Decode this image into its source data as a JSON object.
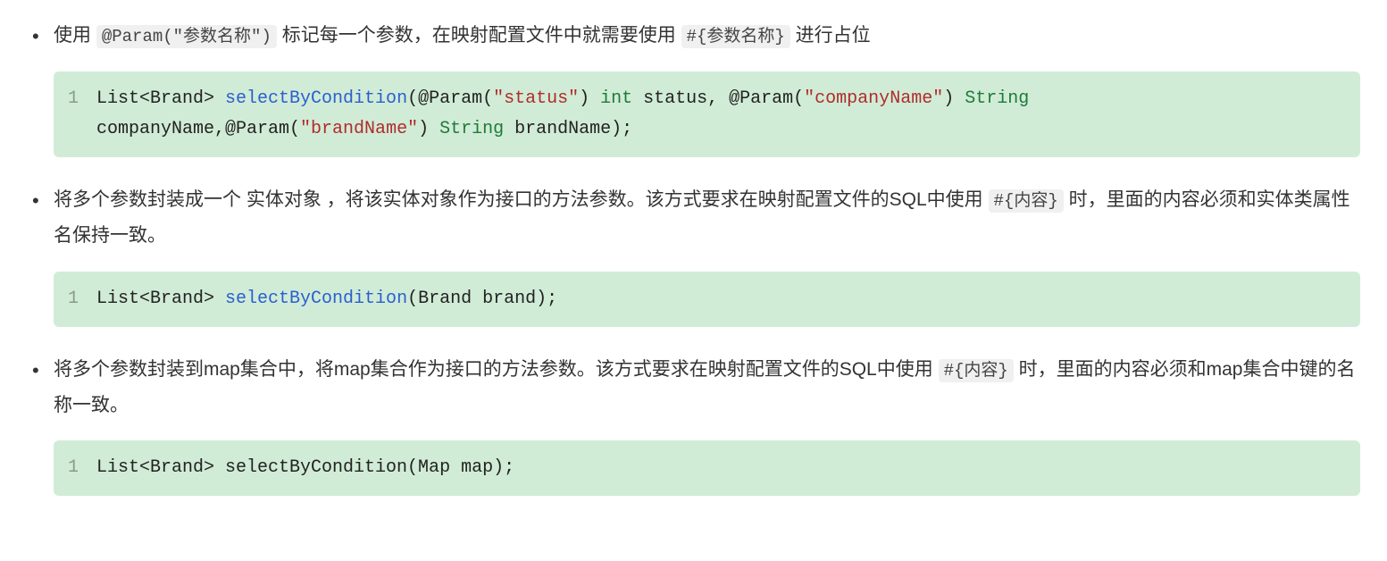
{
  "items": [
    {
      "para_parts": [
        {
          "t": "text",
          "v": "使用 "
        },
        {
          "t": "code",
          "v": "@Param(\"参数名称\")"
        },
        {
          "t": "text",
          "v": " 标记每一个参数，在映射配置文件中就需要使用 "
        },
        {
          "t": "code",
          "v": "#{参数名称}"
        },
        {
          "t": "text",
          "v": " 进行占位"
        }
      ],
      "code_line_no": "1",
      "code_tokens": [
        {
          "c": "plain",
          "v": "List<Brand> "
        },
        {
          "c": "func",
          "v": "selectByCondition"
        },
        {
          "c": "plain",
          "v": "(@Param("
        },
        {
          "c": "str",
          "v": "\"status\""
        },
        {
          "c": "plain",
          "v": ") "
        },
        {
          "c": "kw",
          "v": "int"
        },
        {
          "c": "plain",
          "v": " status, @Param("
        },
        {
          "c": "str",
          "v": "\"companyName\""
        },
        {
          "c": "plain",
          "v": ") "
        },
        {
          "c": "type",
          "v": "String"
        },
        {
          "c": "plain",
          "v": " companyName,@Param("
        },
        {
          "c": "str",
          "v": "\"brandName\""
        },
        {
          "c": "plain",
          "v": ") "
        },
        {
          "c": "type",
          "v": "String"
        },
        {
          "c": "plain",
          "v": " brandName);"
        }
      ]
    },
    {
      "para_parts": [
        {
          "t": "text",
          "v": "将多个参数封装成一个 实体对象 ，将该实体对象作为接口的方法参数。该方式要求在映射配置文件的SQL中使用 "
        },
        {
          "t": "code",
          "v": "#{内容}"
        },
        {
          "t": "text",
          "v": " 时，里面的内容必须和实体类属性名保持一致。"
        }
      ],
      "code_line_no": "1",
      "code_tokens": [
        {
          "c": "plain",
          "v": "List<Brand> "
        },
        {
          "c": "func",
          "v": "selectByCondition"
        },
        {
          "c": "plain",
          "v": "(Brand brand);"
        }
      ]
    },
    {
      "para_parts": [
        {
          "t": "text",
          "v": "将多个参数封装到map集合中，将map集合作为接口的方法参数。该方式要求在映射配置文件的SQL中使用 "
        },
        {
          "t": "code",
          "v": "#{内容}"
        },
        {
          "t": "text",
          "v": " 时，里面的内容必须和map集合中键的名称一致。"
        }
      ],
      "code_line_no": "1",
      "code_tokens": [
        {
          "c": "plain",
          "v": "List<Brand> selectByCondition(Map map);"
        }
      ]
    }
  ]
}
